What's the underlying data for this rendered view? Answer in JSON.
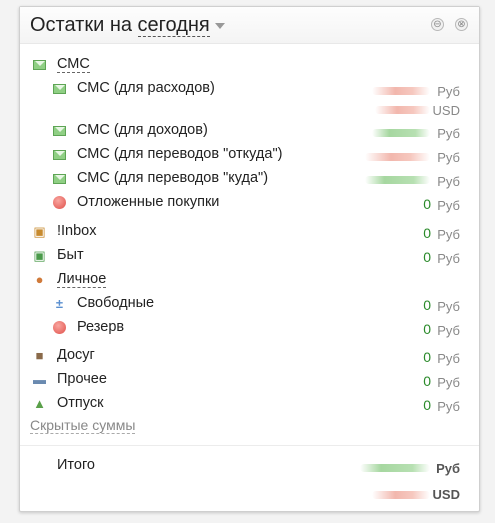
{
  "widget": {
    "title_prefix": "Остатки на ",
    "title_selector": "сегодня",
    "minimize_glyph": "⊖",
    "close_glyph": "⊗"
  },
  "icons": {
    "sms": "envelope-icon",
    "pending": "circle-icon",
    "inbox": "inbox-icon",
    "home": "cart-icon",
    "personal": "person-icon",
    "free": "scale-icon",
    "reserve": "circle-icon",
    "leisure": "camera-icon",
    "other": "truck-icon",
    "vacation": "palm-tree-icon"
  },
  "colors": {
    "positive": "#2a8a2a",
    "blurred_red": "#f2b7ad",
    "blurred_green": "#a6d7a0"
  },
  "rows": [
    {
      "label": "СМС",
      "zero": "",
      "currency": ""
    },
    {
      "label": "СМС (для расходов)",
      "zero": "",
      "currency": "Руб",
      "currency2": "USD"
    },
    {
      "label": "СМС (для доходов)",
      "zero": "",
      "currency": "Руб"
    },
    {
      "label": "СМС (для переводов \"откуда\")",
      "zero": "",
      "currency": "Руб"
    },
    {
      "label": "СМС (для переводов \"куда\")",
      "zero": "",
      "currency": "Руб"
    },
    {
      "label": "Отложенные покупки",
      "zero": "0",
      "currency": "Руб"
    },
    {
      "label": "!Inbox",
      "zero": "0",
      "currency": "Руб"
    },
    {
      "label": "Быт",
      "zero": "0",
      "currency": "Руб"
    },
    {
      "label": "Личное",
      "zero": "",
      "currency": ""
    },
    {
      "label": "Свободные",
      "zero": "0",
      "currency": "Руб"
    },
    {
      "label": "Резерв",
      "zero": "0",
      "currency": "Руб"
    },
    {
      "label": "Досуг",
      "zero": "0",
      "currency": "Руб"
    },
    {
      "label": "Прочее",
      "zero": "0",
      "currency": "Руб"
    },
    {
      "label": "Отпуск",
      "zero": "0",
      "currency": "Руб"
    }
  ],
  "hidden_sums_label": "Скрытые суммы",
  "total": {
    "label": "Итого",
    "currency1": "Руб",
    "currency2": "USD"
  }
}
